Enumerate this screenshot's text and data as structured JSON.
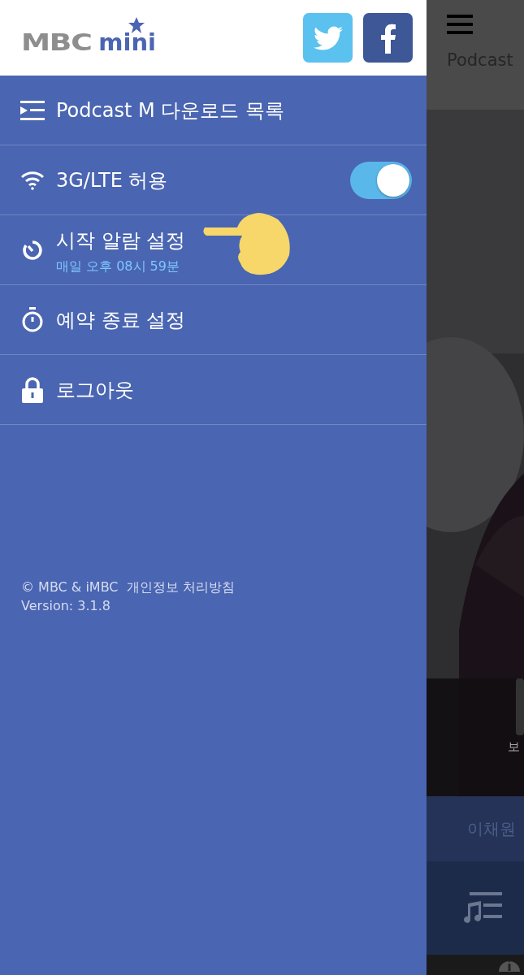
{
  "drawer": {
    "logo": {
      "primary": "MBC",
      "secondary": "mini"
    },
    "social": [
      {
        "kind": "twitter"
      },
      {
        "kind": "facebook"
      }
    ],
    "menu": [
      {
        "kind": "downloads",
        "label": "Podcast M 다운로드 목록"
      },
      {
        "kind": "network",
        "label": "3G/LTE 허용",
        "on": true
      },
      {
        "kind": "alarm",
        "label": "시작 알람 설정",
        "subtitle": "매일 오후 08시 59분"
      },
      {
        "kind": "timer",
        "label": "예약 종료 설정"
      },
      {
        "kind": "logout",
        "label": "로그아웃"
      }
    ],
    "footer": {
      "copyright": "© MBC & iMBC",
      "privacy_link": "개인정보 처리방침",
      "version": "Version: 3.1.8"
    }
  },
  "background_app": {
    "header_title": "Podcast",
    "caption": "보",
    "name_bar": "이채원"
  }
}
